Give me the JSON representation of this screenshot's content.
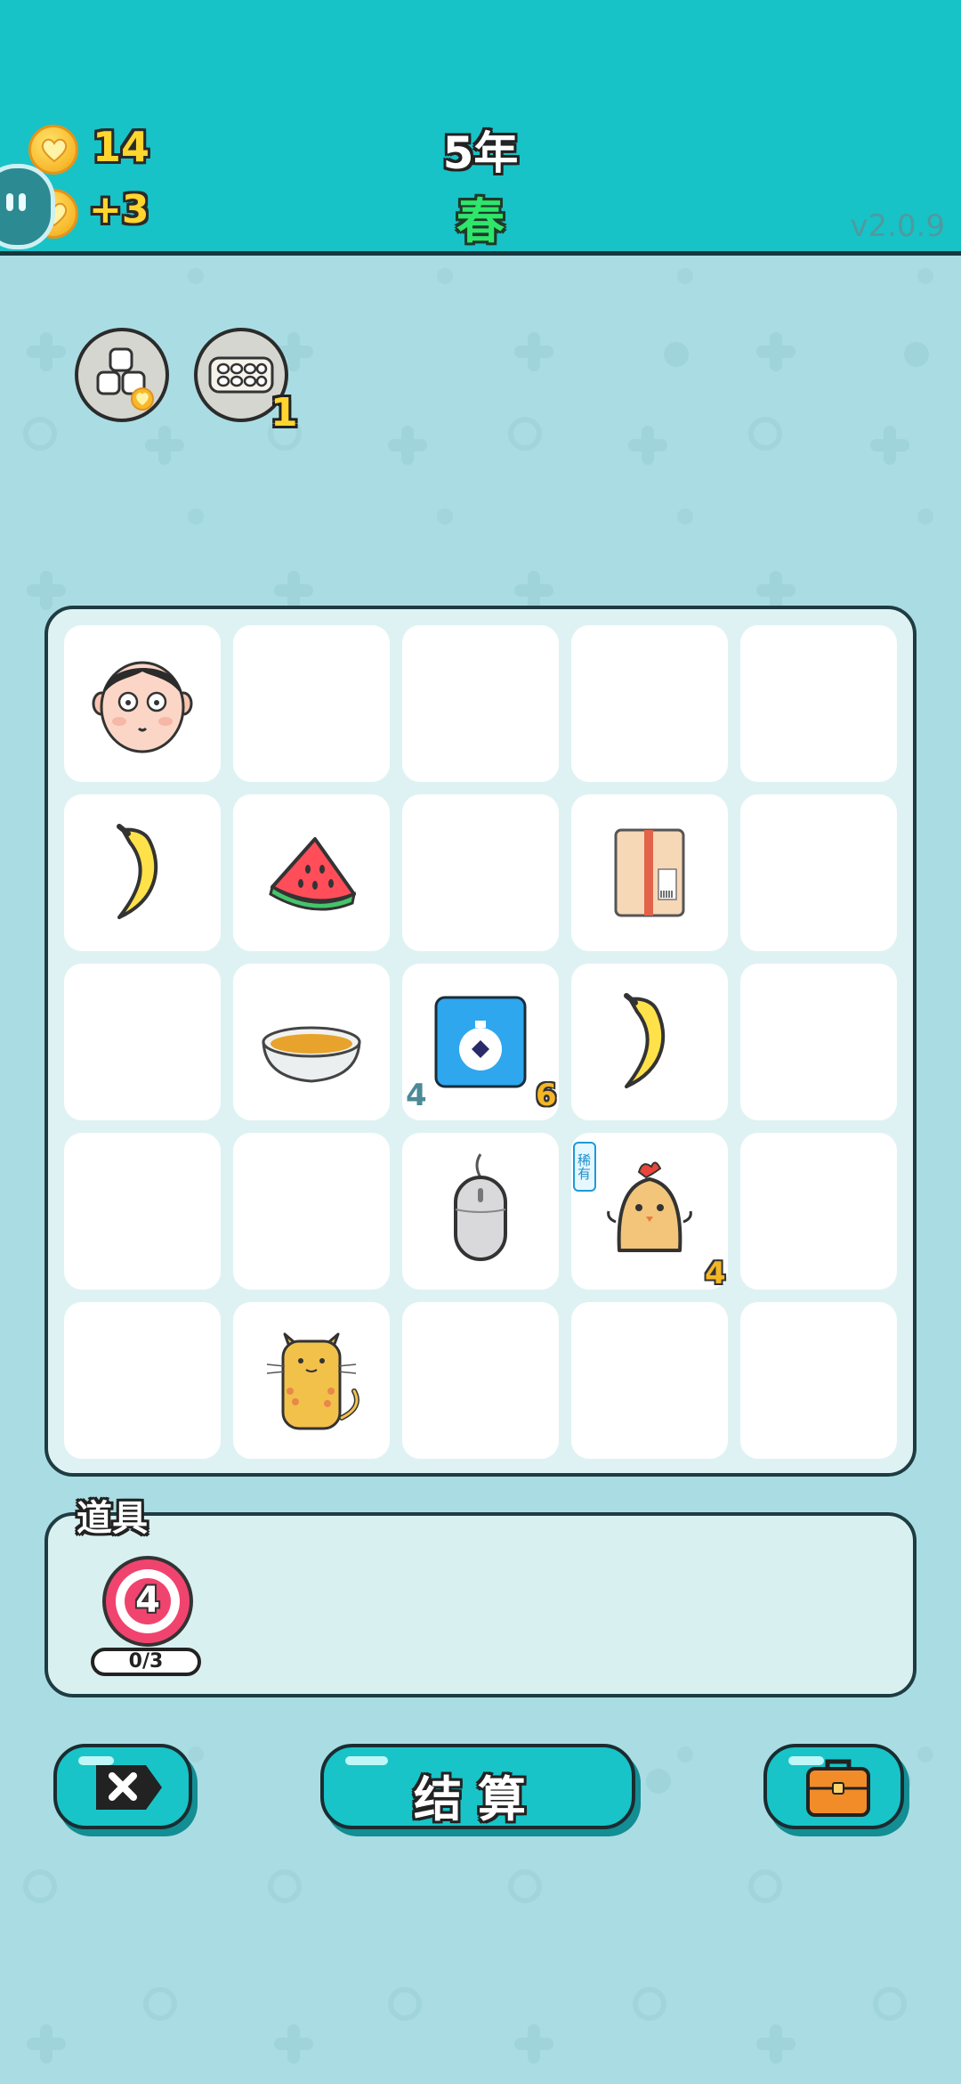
{
  "header": {
    "coins": "14",
    "income": "+3",
    "year": "5年",
    "season": "春",
    "version": "v2.0.9"
  },
  "badges": {
    "second_count": "1"
  },
  "grid": {
    "cells": [
      {
        "row": 0,
        "col": 0,
        "item": "face-icon"
      },
      {
        "row": 1,
        "col": 0,
        "item": "banana-icon"
      },
      {
        "row": 1,
        "col": 1,
        "item": "watermelon-icon"
      },
      {
        "row": 1,
        "col": 3,
        "item": "box-icon"
      },
      {
        "row": 2,
        "col": 1,
        "item": "bowl-icon"
      },
      {
        "row": 2,
        "col": 2,
        "item": "stopwatch-icon",
        "left_num": "4",
        "right_num": "6"
      },
      {
        "row": 2,
        "col": 3,
        "item": "banana-icon"
      },
      {
        "row": 3,
        "col": 2,
        "item": "mouse-icon"
      },
      {
        "row": 3,
        "col": 3,
        "item": "chick-icon",
        "tag": "稀有",
        "right_num": "4"
      },
      {
        "row": 4,
        "col": 1,
        "item": "cat-icon"
      }
    ],
    "stopwatch_left": "4",
    "stopwatch_right": "6",
    "chick_tag": "稀有",
    "chick_num": "4"
  },
  "items": {
    "title": "道具",
    "target_num": "4",
    "progress": "0/3"
  },
  "buttons": {
    "settle": "结算"
  },
  "colors": {
    "header": "#17c3c7",
    "background": "#a9dde3",
    "button": "#18c4c8",
    "season": "#2ee66a",
    "coin_number": "#ffd52e"
  }
}
